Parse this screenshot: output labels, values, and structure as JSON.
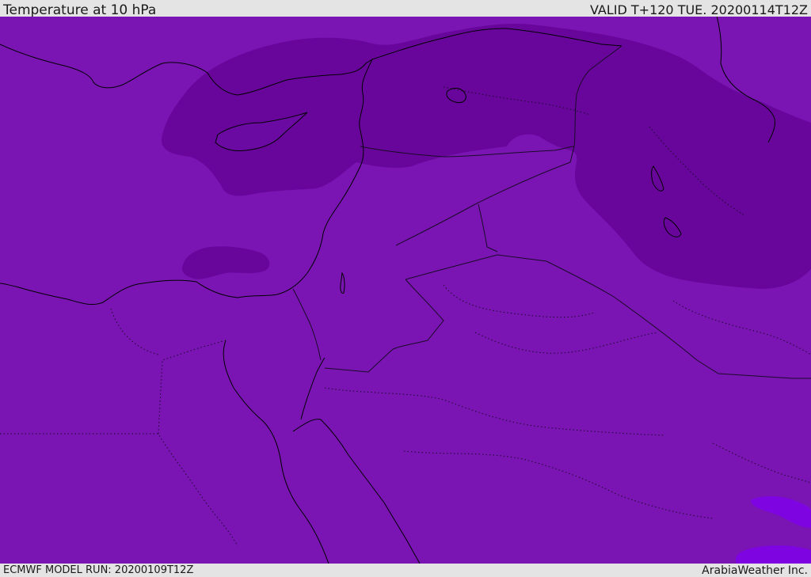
{
  "header": {
    "title": "Temperature at 10 hPa",
    "valid": "VALID T+120 TUE. 20200114T12Z"
  },
  "footer": {
    "model_run": "ECMWF MODEL RUN: 20200109T12Z",
    "credit": "ArabiaWeather Inc."
  },
  "map": {
    "colors": {
      "background_band": "#7a15b4",
      "cold_band": "#68069c",
      "warm_band": "#7f04e2",
      "coastline": "#000000",
      "borders": "#1a0a26"
    }
  }
}
